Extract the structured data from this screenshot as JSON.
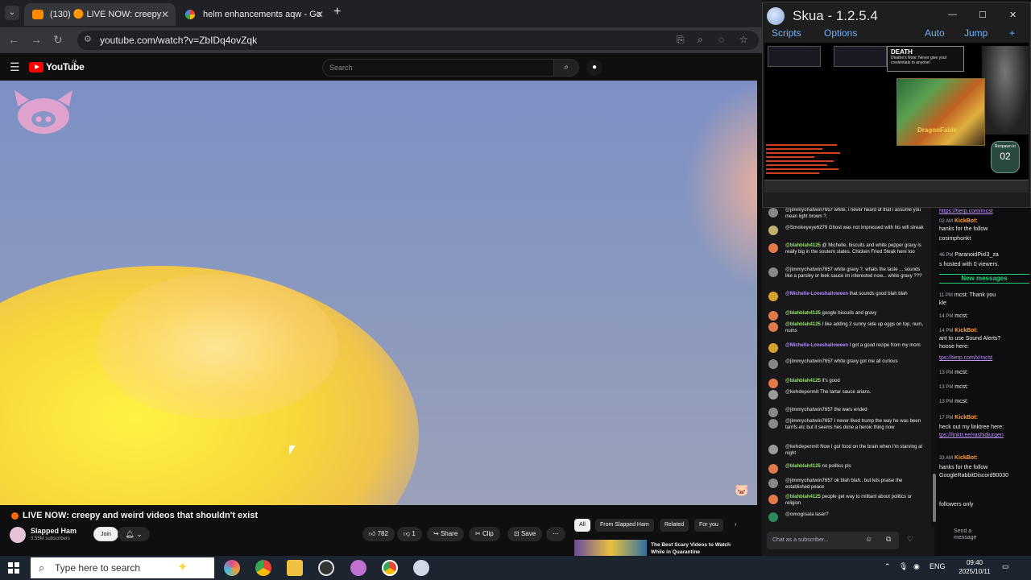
{
  "browser": {
    "tabs": [
      {
        "label": "(130) 🟠 LIVE NOW: creepy",
        "active": true
      },
      {
        "label": "helm enhancements aqw - Go",
        "active": false
      }
    ],
    "new_tab_glyph": "+",
    "url": "youtube.com/watch?v=ZbIDq4ovZqk"
  },
  "youtube": {
    "logo_text": "YouTube",
    "logo_country": "ZA",
    "search_placeholder": "Search",
    "video_title": "LIVE NOW: creepy and weird videos that shouldn't exist",
    "channel_name": "Slapped Ham",
    "channel_subs": "3.55M subscribers",
    "join_label": "Join",
    "like_count": "782",
    "dislike_count": "1",
    "share_label": "Share",
    "clip_label": "Clip",
    "save_label": "Save",
    "chips": [
      "All",
      "From Slapped Ham",
      "Related",
      "For you"
    ],
    "rec_title": "The Best Scary Videos to Watch While in Quarantine"
  },
  "skua": {
    "title": "Skua - 1.2.5.4",
    "menu_left": [
      "Scripts",
      "Options"
    ],
    "menu_right": [
      "Auto",
      "Jump",
      "+"
    ],
    "death_title": "DEATH",
    "death_text": "Deathe's Note: Never give your credentials to anyone!",
    "game_logo": "DragonFable",
    "respawn_label": "Respawn in",
    "respawn_count": "02"
  },
  "chat": {
    "messages": [
      {
        "user": "@jimmychatwin7657",
        "text": "white, i never heard of that i assume you mean light brown ?.",
        "color": "#bbbbbb",
        "av": "#888888"
      },
      {
        "user": "@Smokeyeye6279",
        "text": "Ghost was not impressed with his wifi streak",
        "color": "#bbbbbb",
        "av": "#c0b070"
      },
      {
        "user": "@blahblah4125",
        "text": "@ Michelle, biscuits and white pepper gravy is really big in the soutern states. Chicken Fried Steak here too",
        "color": "#9be36a",
        "av": "#e07a4a"
      },
      {
        "user": "@jimmychatwin7657",
        "text": "white gravy ?. whats the taste ... sounds like a parsley or leek sauce im interested now... white gravy ???",
        "color": "#bbbbbb",
        "av": "#888888"
      },
      {
        "user": "@Michelle-Loveshalloween",
        "text": "that sounds good blah blah",
        "color": "#b38cff",
        "av": "#d9a030"
      },
      {
        "user": "@blahblah4125",
        "text": "google biscuits and gravy",
        "color": "#9be36a",
        "av": "#e07a4a"
      },
      {
        "user": "@blahblah4125",
        "text": "I like adding 2 sunny side up eggs on top, num, nums",
        "color": "#9be36a",
        "av": "#e07a4a"
      },
      {
        "user": "@Michelle-Loveshalloween",
        "text": "I got a good recipe from my mom",
        "color": "#b38cff",
        "av": "#d9a030"
      },
      {
        "user": "@jimmychatwin7657",
        "text": "white gravy got me all curious",
        "color": "#bbbbbb",
        "av": "#888888"
      },
      {
        "user": "@blahblah4125",
        "text": "it's good",
        "color": "#9be36a",
        "av": "#e07a4a"
      },
      {
        "user": "@kehdepermit",
        "text": "The tartar sauce arians.",
        "color": "#bbbbbb",
        "av": "#999999"
      },
      {
        "user": "@jimmychatwin7657",
        "text": "the wars ended",
        "color": "#bbbbbb",
        "av": "#888888"
      },
      {
        "user": "@jimmychatwin7657",
        "text": "I never liked trump the way he was been tarrifs etc but it seems hes done a heroic thing now",
        "color": "#bbbbbb",
        "av": "#888888"
      },
      {
        "user": "@kehdepermit",
        "text": "Now I got food on the brain when I'm starving at night",
        "color": "#bbbbbb",
        "av": "#999999"
      },
      {
        "user": "@blahblah4125",
        "text": "no politics pls",
        "color": "#9be36a",
        "av": "#e07a4a"
      },
      {
        "user": "@jimmychatwin7657",
        "text": "ok blah blah.. but lets praise the established peace",
        "color": "#bbbbbb",
        "av": "#888888"
      },
      {
        "user": "@blahblah4125",
        "text": "people get way to militant about politics or religion",
        "color": "#9be36a",
        "av": "#e07a4a"
      },
      {
        "user": "@omogisala",
        "text": "laser?",
        "color": "#bbbbbb",
        "av": "#2a8a5a"
      }
    ],
    "input_placeholder": "Chat as a subscriber..."
  },
  "side_feed": {
    "items": [
      {
        "time": "",
        "bot": "",
        "text": "https://tierp.com/mcst",
        "link": true
      },
      {
        "time": "02 AM",
        "bot": "KickBot:",
        "text": "",
        "link": false
      },
      {
        "time": "",
        "bot": "",
        "text": "hanks for the follow",
        "link": false
      },
      {
        "time": "",
        "bot": "",
        "text": "cosimphonkt",
        "link": false
      },
      {
        "time": "46 PM",
        "bot": "",
        "text": "ParanoidPixl3_za",
        "link": false
      },
      {
        "time": "",
        "bot": "",
        "text": "s hosted with 0 viewers.",
        "link": false
      },
      {
        "time": "11 PM",
        "bot": "",
        "text": "mcst: Thank you",
        "link": false
      },
      {
        "time": "",
        "bot": "",
        "text": "kle",
        "link": false
      },
      {
        "time": "14 PM",
        "bot": "",
        "text": "mcst:",
        "link": false
      },
      {
        "time": "14 PM",
        "bot": "KickBot:",
        "text": "",
        "link": false
      },
      {
        "time": "",
        "bot": "",
        "text": "ant to use Sound Alerts?",
        "link": false
      },
      {
        "time": "",
        "bot": "",
        "text": "hoose here:",
        "link": false
      },
      {
        "time": "",
        "bot": "",
        "text": "tps://tierp.com/x/mcst",
        "link": true
      },
      {
        "time": "13 PM",
        "bot": "",
        "text": "mcst:",
        "link": false
      },
      {
        "time": "13 PM",
        "bot": "",
        "text": "mcst:",
        "link": false
      },
      {
        "time": "13 PM",
        "bot": "",
        "text": "mcst:",
        "link": false
      },
      {
        "time": "17 PM",
        "bot": "KickBot:",
        "text": "",
        "link": false
      },
      {
        "time": "",
        "bot": "",
        "text": "heck out my linktree here:",
        "link": false
      },
      {
        "time": "",
        "bot": "",
        "text": "tps://linktr.ee/rashidjurgen",
        "link": true
      },
      {
        "time": "33 AM",
        "bot": "KickBot:",
        "text": "",
        "link": false
      },
      {
        "time": "",
        "bot": "",
        "text": "hanks for the follow",
        "link": false
      },
      {
        "time": "",
        "bot": "",
        "text": "GoogleRabbitDiscord90030",
        "link": false
      },
      {
        "time": "",
        "bot": "",
        "text": "followers only",
        "link": false
      }
    ],
    "new_messages_label": "New messages",
    "send_label": "Send a message"
  },
  "taskbar": {
    "search_placeholder": "Type here to search",
    "language": "ENG",
    "time": "09:40",
    "date": "2025/10/11"
  }
}
